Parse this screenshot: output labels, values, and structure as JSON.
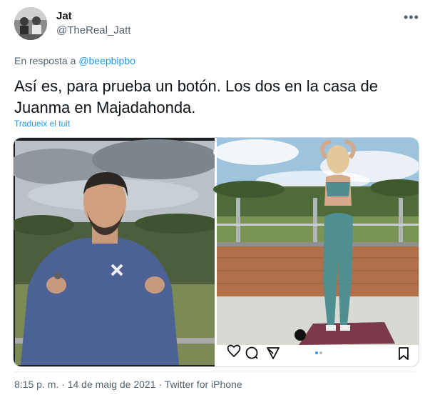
{
  "author": {
    "display_name": "Jat",
    "handle": "@TheReal_Jatt",
    "avatar_icon": "avatar-photo"
  },
  "more_icon": "more-horizontal-icon",
  "reply": {
    "prefix": "En resposta a",
    "mention": "@beepbipbo"
  },
  "tweet": {
    "text": "Así es, para prueba un botón. Los dos en la casa de Juanma en Majadahonda.",
    "translate_label": "Tradueix el tuit"
  },
  "media": {
    "left_image": "man-in-blue-sweater-video-frame",
    "right_image": "woman-in-teal-activewear-on-terrace",
    "action_icons": [
      "heart-icon",
      "comment-icon",
      "share-icon",
      "bookmark-icon"
    ],
    "carousel_dots": 2,
    "active_dot": 0
  },
  "meta": {
    "time": "8:15 p. m.",
    "separator": "·",
    "date": "14 de maig de 2021",
    "source": "Twitter for iPhone"
  },
  "colors": {
    "link": "#1d9bf0",
    "secondary_text": "#536471",
    "primary_text": "#0f1419"
  }
}
